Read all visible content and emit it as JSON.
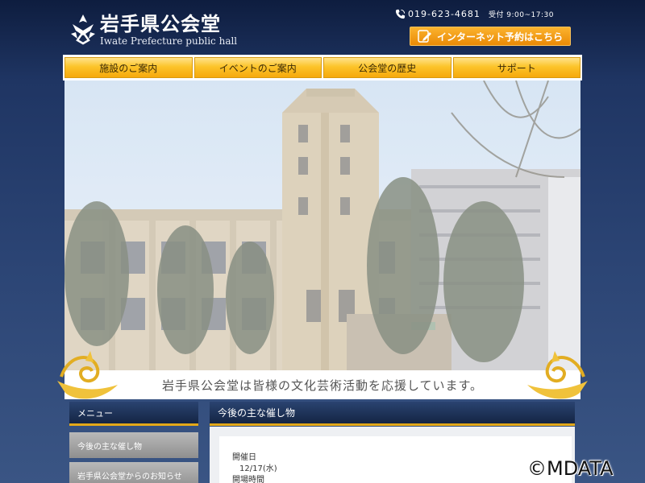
{
  "header": {
    "logo_title": "岩手県公会堂",
    "logo_subtitle": "Iwate Prefecture public hall",
    "phone": "019-623-4681",
    "hours": "受付 9:00~17:30",
    "reserve_label": "インターネット予約はこちら"
  },
  "nav": {
    "items": [
      {
        "label": "施設のご案内"
      },
      {
        "label": "イベントのご案内"
      },
      {
        "label": "公会堂の歴史"
      },
      {
        "label": "サポート"
      }
    ]
  },
  "hero": {
    "tagline": "岩手県公会堂は皆様の文化芸術活動を応援しています。"
  },
  "sidebar": {
    "title": "メニュー",
    "items": [
      {
        "label": "今後の主な催し物"
      },
      {
        "label": "岩手県公会堂からのお知らせ"
      }
    ]
  },
  "main": {
    "title": "今後の主な催し物",
    "event": {
      "date_label": "開催日",
      "date_value": "12/17(水)",
      "time_label": "開場時間"
    }
  },
  "watermark": "©MDATA",
  "colors": {
    "nav_gold": "#fcc42a",
    "reserve_orange": "#f29a13",
    "header_navy": "#142544",
    "accent_gold": "#e3a818"
  }
}
